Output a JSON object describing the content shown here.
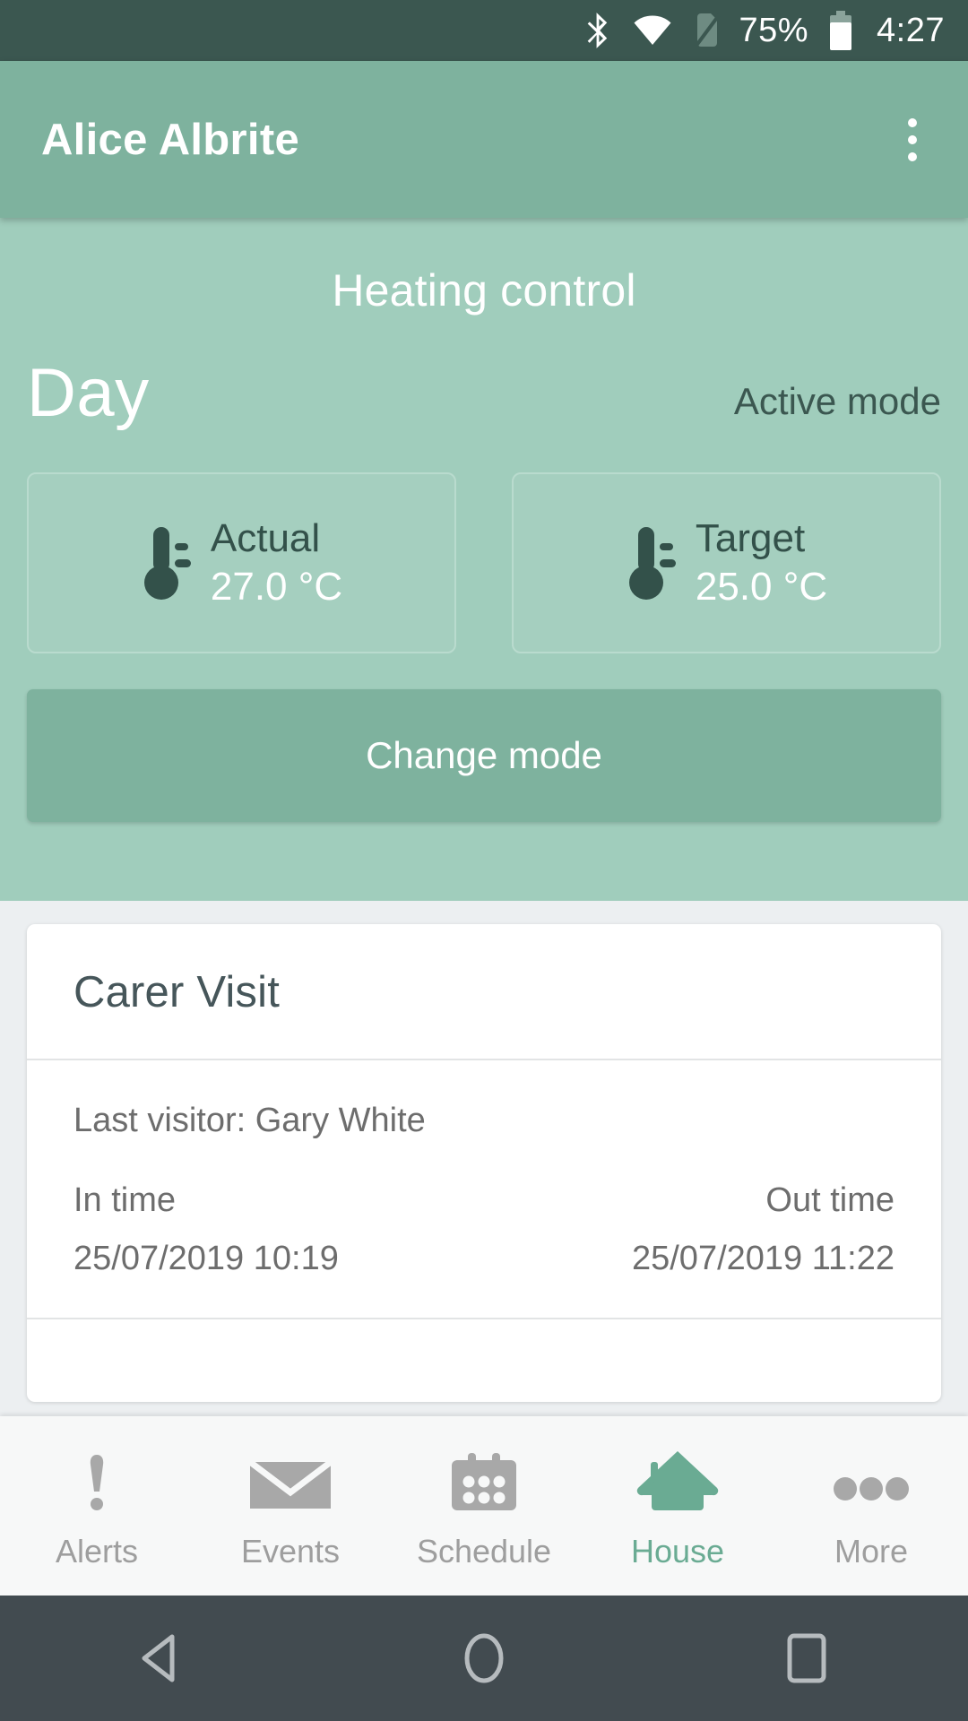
{
  "statusbar": {
    "bluetooth_icon": "bluetooth-icon",
    "wifi_icon": "wifi-icon",
    "sim_off_icon": "sim-off-icon",
    "battery_percent": "75%",
    "battery_icon": "battery-icon",
    "time": "4:27"
  },
  "appbar": {
    "title": "Alice Albrite",
    "overflow_icon": "overflow-menu-icon"
  },
  "heating": {
    "section_title": "Heating control",
    "mode_name": "Day",
    "mode_state": "Active mode",
    "cards": [
      {
        "label": "Actual",
        "value": "27.0 °C",
        "icon": "thermometer-icon"
      },
      {
        "label": "Target",
        "value": "25.0 °C",
        "icon": "thermometer-icon"
      }
    ],
    "change_mode_label": "Change mode"
  },
  "carer_visit": {
    "title": "Carer Visit",
    "last_visitor": "Last visitor: Gary White",
    "in_label": "In time",
    "in_value": "25/07/2019 10:19",
    "out_label": "Out time",
    "out_value": "25/07/2019 11:22"
  },
  "bottomnav": {
    "items": [
      {
        "label": "Alerts",
        "icon": "alert-icon",
        "active": false
      },
      {
        "label": "Events",
        "icon": "envelope-icon",
        "active": false
      },
      {
        "label": "Schedule",
        "icon": "calendar-icon",
        "active": false
      },
      {
        "label": "House",
        "icon": "house-icon",
        "active": true
      },
      {
        "label": "More",
        "icon": "more-icon",
        "active": false
      }
    ]
  },
  "androidnav": {
    "back_icon": "back-triangle-icon",
    "home_icon": "home-circle-icon",
    "recents_icon": "recents-square-icon"
  },
  "colors": {
    "statusbar_bg": "#3b5750",
    "appbar_bg": "#7eb29e",
    "heating_bg": "#a0cdbc",
    "accent": "#6aab93",
    "content_bg": "#eceff1",
    "nav_bg": "#f7f8f8",
    "android_nav_bg": "#424b50",
    "dark_text": "#33514a",
    "muted_text": "#6d6d6d"
  }
}
